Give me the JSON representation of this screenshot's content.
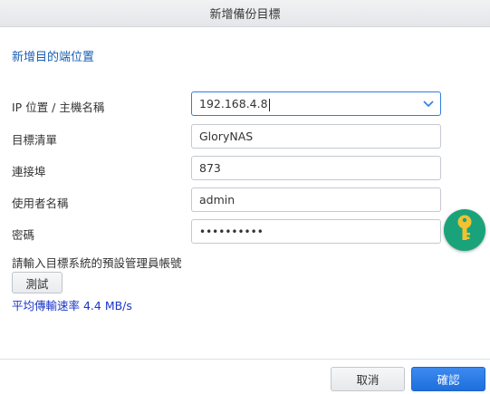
{
  "window": {
    "title": "新增備份目標"
  },
  "section": {
    "title": "新增目的端位置"
  },
  "fields": {
    "ip": {
      "label": "IP 位置 / 主機名稱",
      "value": "192.168.4.8"
    },
    "target_list": {
      "label": "目標清單",
      "value": "GloryNAS"
    },
    "port": {
      "label": "連接埠",
      "value": "873"
    },
    "username": {
      "label": "使用者名稱",
      "value": "admin"
    },
    "password": {
      "label": "密碼",
      "value": "••••••••••"
    }
  },
  "hint": "請輸入目標系統的預設管理員帳號",
  "test_button": "測試",
  "transfer_rate": "平均傳輸速率 4.4 MB/s",
  "footer": {
    "cancel": "取消",
    "ok": "確認"
  },
  "colors": {
    "accent": "#1e6fdc",
    "key_button": "#1aa37a",
    "link_blue": "#1a35c8"
  },
  "icons": {
    "dropdown": "chevron-down-icon",
    "key": "key-icon"
  }
}
